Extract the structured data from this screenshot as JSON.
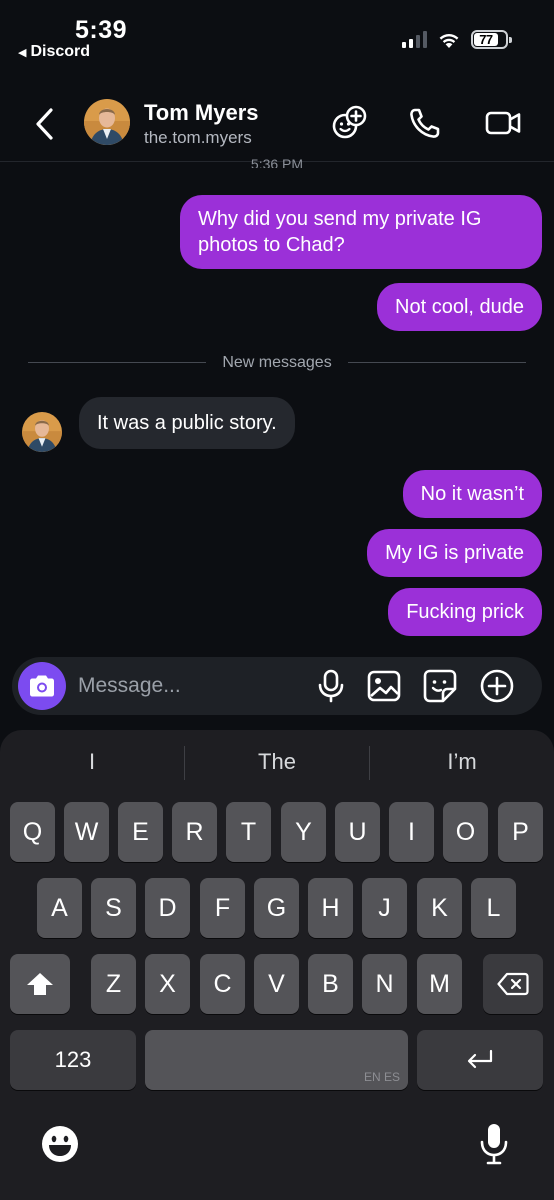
{
  "status_bar": {
    "time": "5:39",
    "back_app": "Discord",
    "battery": "77"
  },
  "header": {
    "name": "Tom Myers",
    "username": "the.tom.myers"
  },
  "timestamp_partial": "5:36 PM",
  "messages": [
    {
      "dir": "out",
      "text": "Why did you send my private IG photos to Chad?"
    },
    {
      "dir": "out",
      "text": "Not cool, dude"
    },
    {
      "dir": "in",
      "text": "It was a public story."
    },
    {
      "dir": "out",
      "text": "No it wasn’t"
    },
    {
      "dir": "out",
      "text": "My IG is private"
    },
    {
      "dir": "out",
      "text": "Fucking prick"
    }
  ],
  "divider_label": "New messages",
  "composer": {
    "placeholder": "Message..."
  },
  "keyboard": {
    "suggestions": [
      "I",
      "The",
      "I’m"
    ],
    "row1": [
      "Q",
      "W",
      "E",
      "R",
      "T",
      "Y",
      "U",
      "I",
      "O",
      "P"
    ],
    "row2": [
      "A",
      "S",
      "D",
      "F",
      "G",
      "H",
      "J",
      "K",
      "L"
    ],
    "row3": [
      "Z",
      "X",
      "C",
      "V",
      "B",
      "N",
      "M"
    ],
    "numbers_key": "123",
    "space_lang": "EN ES"
  },
  "colors": {
    "outgoing_bubble": "#9b30d8",
    "incoming_bubble": "#25282e",
    "accent": "#7c4bf0",
    "background": "#0c0e12"
  },
  "icons": [
    "back-chevron-icon",
    "add-friend-icon",
    "phone-icon",
    "video-icon",
    "camera-icon",
    "microphone-icon",
    "image-icon",
    "sticker-icon",
    "plus-circle-icon",
    "shift-icon",
    "backspace-icon",
    "return-icon",
    "emoji-icon",
    "dictation-icon"
  ]
}
